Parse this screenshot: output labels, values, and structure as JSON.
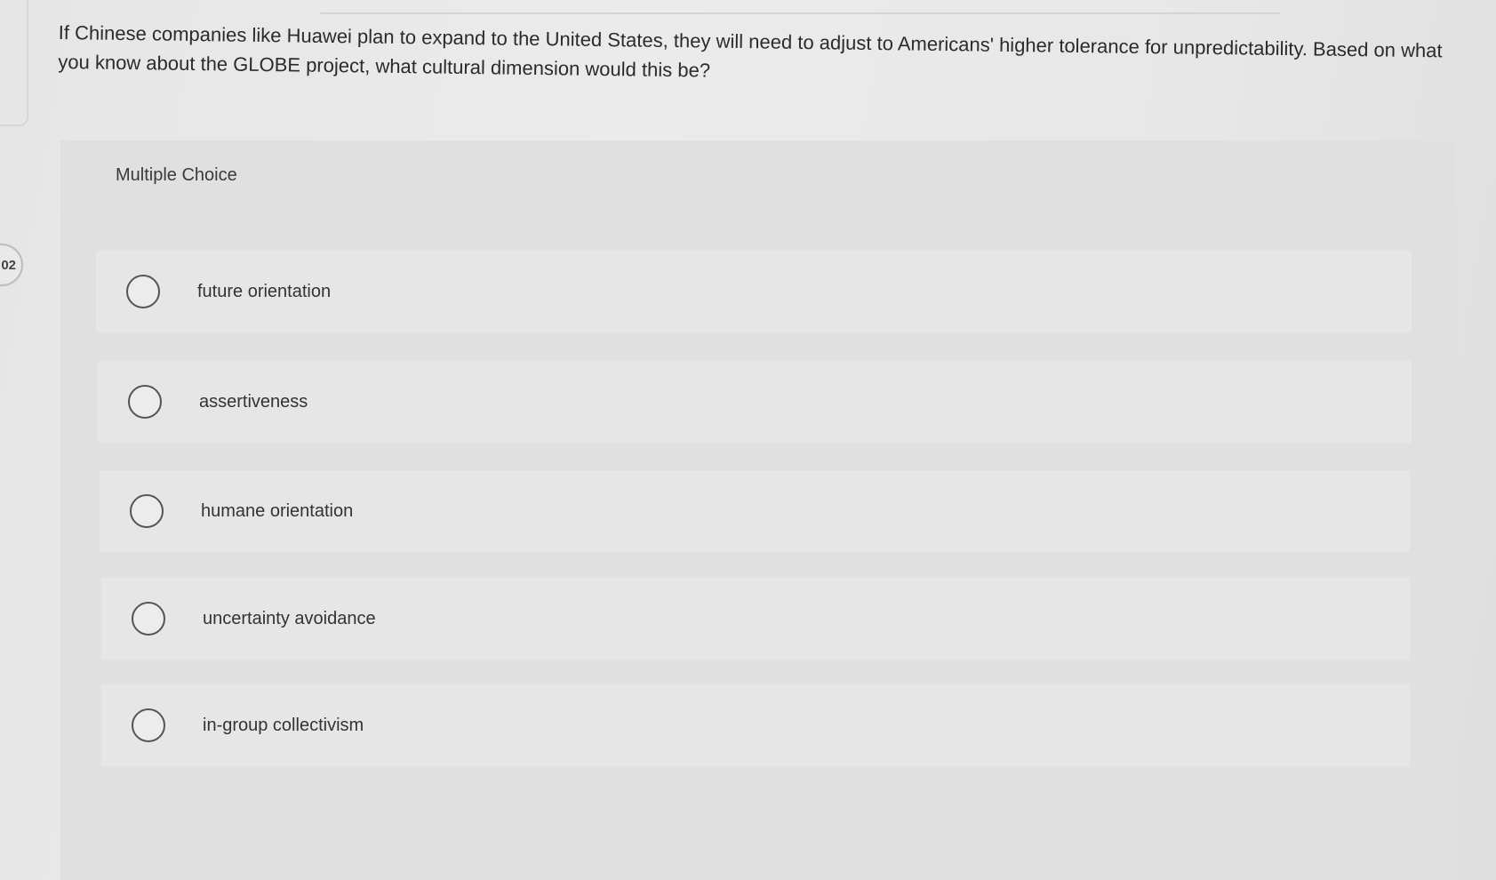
{
  "question": {
    "number": "02",
    "text": "If Chinese companies like Huawei plan to expand to the United States, they will need to adjust to Americans' higher tolerance for unpredictability. Based on what you know about the GLOBE project, what cultural dimension would this be?"
  },
  "answer_panel": {
    "title": "Multiple Choice",
    "options": [
      {
        "label": "future orientation",
        "selected": false
      },
      {
        "label": "assertiveness",
        "selected": false
      },
      {
        "label": "humane orientation",
        "selected": false
      },
      {
        "label": "uncertainty avoidance",
        "selected": false
      },
      {
        "label": "in-group collectivism",
        "selected": false
      }
    ]
  },
  "colors": {
    "background": "#e8e8e8",
    "panel": "#e0e0e0",
    "option": "#e6e6e6",
    "text": "#2b2b2b",
    "radio_border": "#555555"
  }
}
